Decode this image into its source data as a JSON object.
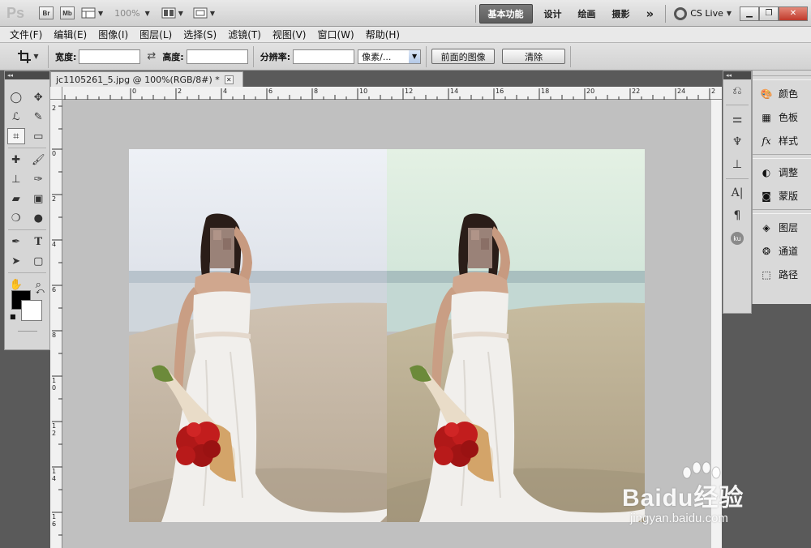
{
  "app": {
    "logo": "Ps",
    "zoom": "100%"
  },
  "titlebar": {
    "buttons": [
      "Br",
      "Mb"
    ],
    "workspaces": [
      "基本功能",
      "设计",
      "绘画",
      "摄影"
    ],
    "more": "»",
    "cs_live": "CS Live"
  },
  "menu": [
    "文件(F)",
    "编辑(E)",
    "图像(I)",
    "图层(L)",
    "选择(S)",
    "滤镜(T)",
    "视图(V)",
    "窗口(W)",
    "帮助(H)"
  ],
  "options": {
    "width_label": "宽度:",
    "width_value": "",
    "swap_icon": "⇄",
    "height_label": "高度:",
    "height_value": "",
    "resolution_label": "分辨率:",
    "resolution_value": "",
    "unit_select": "像素/...",
    "front_image_button": "前面的图像",
    "clear_button": "清除"
  },
  "document": {
    "tab_title": "jc1105261_5.jpg @ 100%(RGB/8#) *",
    "ruler_h_labels": [
      "0",
      "2",
      "4",
      "6",
      "8",
      "10",
      "12",
      "14",
      "16",
      "18",
      "20",
      "22",
      "24",
      "2"
    ],
    "ruler_v_labels": [
      "2",
      "0",
      "2",
      "4",
      "6",
      "8",
      "1 0",
      "1 2",
      "1 4",
      "1 6"
    ]
  },
  "right_panels": {
    "group1": [
      "颜色",
      "色板",
      "样式"
    ],
    "group2": [
      "调整",
      "蒙版"
    ],
    "group3": [
      "图层",
      "通道",
      "路径"
    ]
  },
  "colors": {
    "foreground": "#000000",
    "background": "#ffffff",
    "active_workspace": "#666666"
  },
  "watermark": {
    "brand": "Baidu经验",
    "url": "jingyan.baidu.com"
  }
}
